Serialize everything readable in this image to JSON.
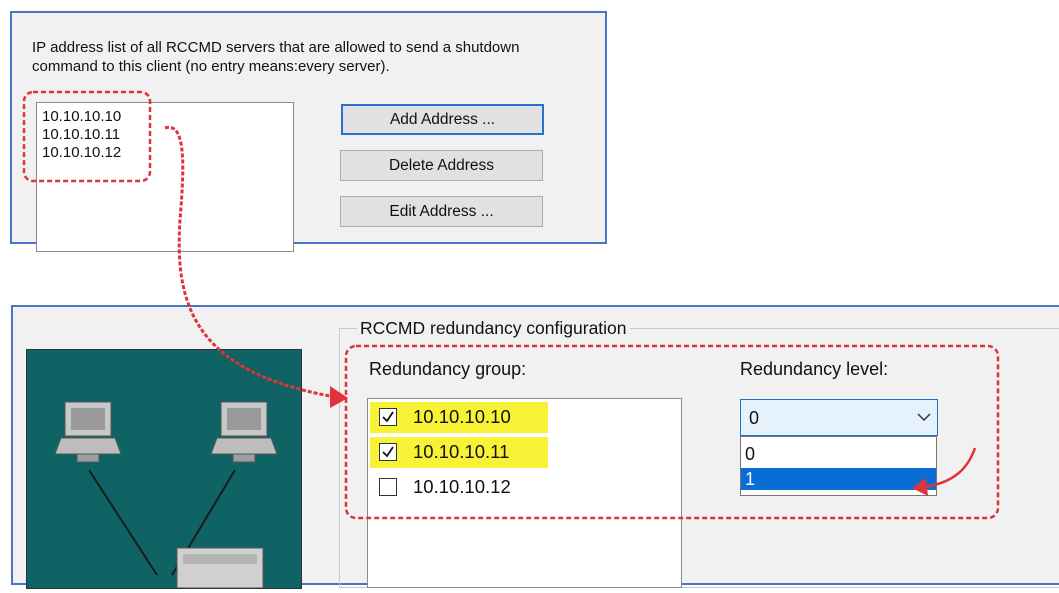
{
  "rccmd_servers": {
    "description": "IP address list of all RCCMD servers that are allowed to send a shutdown command to this client (no entry means:every server).",
    "addresses": [
      "10.10.10.10",
      "10.10.10.11",
      "10.10.10.12"
    ],
    "add_button": "Add Address ...",
    "delete_button": "Delete Address",
    "edit_button": "Edit Address ..."
  },
  "redundancy": {
    "group_title": "RCCMD redundancy configuration",
    "group_label": "Redundancy group:",
    "level_label": "Redundancy level:",
    "group_items": [
      {
        "label": "10.10.10.10",
        "checked": true
      },
      {
        "label": "10.10.10.11",
        "checked": true
      },
      {
        "label": "10.10.10.12",
        "checked": false
      }
    ],
    "level_selected": "0",
    "level_options": [
      "0",
      "1"
    ],
    "level_highlighted": "1"
  },
  "colors": {
    "panel_border": "#4a74c4",
    "annotation_red": "#e0323a",
    "highlight_yellow": "#f7f236",
    "selection_blue": "#0a6dd6",
    "diagram_bg": "#0f6365"
  },
  "icons": [
    "checkbox-checked-icon",
    "checkbox-empty-icon",
    "chevron-down-icon",
    "computer-icon",
    "server-icon",
    "annotation-arrow-icon"
  ]
}
